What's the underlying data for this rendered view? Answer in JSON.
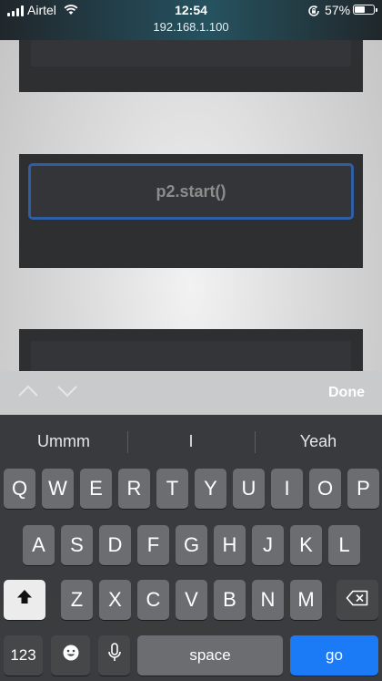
{
  "status_bar": {
    "carrier": "Airtel",
    "time": "12:54",
    "url": "192.168.1.100",
    "battery_percent": "57%",
    "battery_level": 0.57,
    "icons": [
      "signal-icon",
      "wifi-icon",
      "orientation-lock-icon",
      "battery-icon"
    ]
  },
  "page": {
    "code_text": "p2.start()",
    "focus_color": "#2f5ea6"
  },
  "accessory_bar": {
    "done_label": "Done",
    "icons": [
      "previous-field-chevron-up-icon",
      "next-field-chevron-down-icon"
    ]
  },
  "keyboard": {
    "suggestions": [
      "Ummm",
      "I",
      "Yeah"
    ],
    "row1": [
      "Q",
      "W",
      "E",
      "R",
      "T",
      "Y",
      "U",
      "I",
      "O",
      "P"
    ],
    "row2": [
      "A",
      "S",
      "D",
      "F",
      "G",
      "H",
      "J",
      "K",
      "L"
    ],
    "row3": [
      "Z",
      "X",
      "C",
      "V",
      "B",
      "N",
      "M"
    ],
    "numbers_label": "123",
    "space_label": "space",
    "go_label": "go",
    "go_color": "#1b7af5",
    "icons": [
      "shift-icon",
      "delete-icon",
      "emoji-icon",
      "microphone-icon"
    ]
  }
}
